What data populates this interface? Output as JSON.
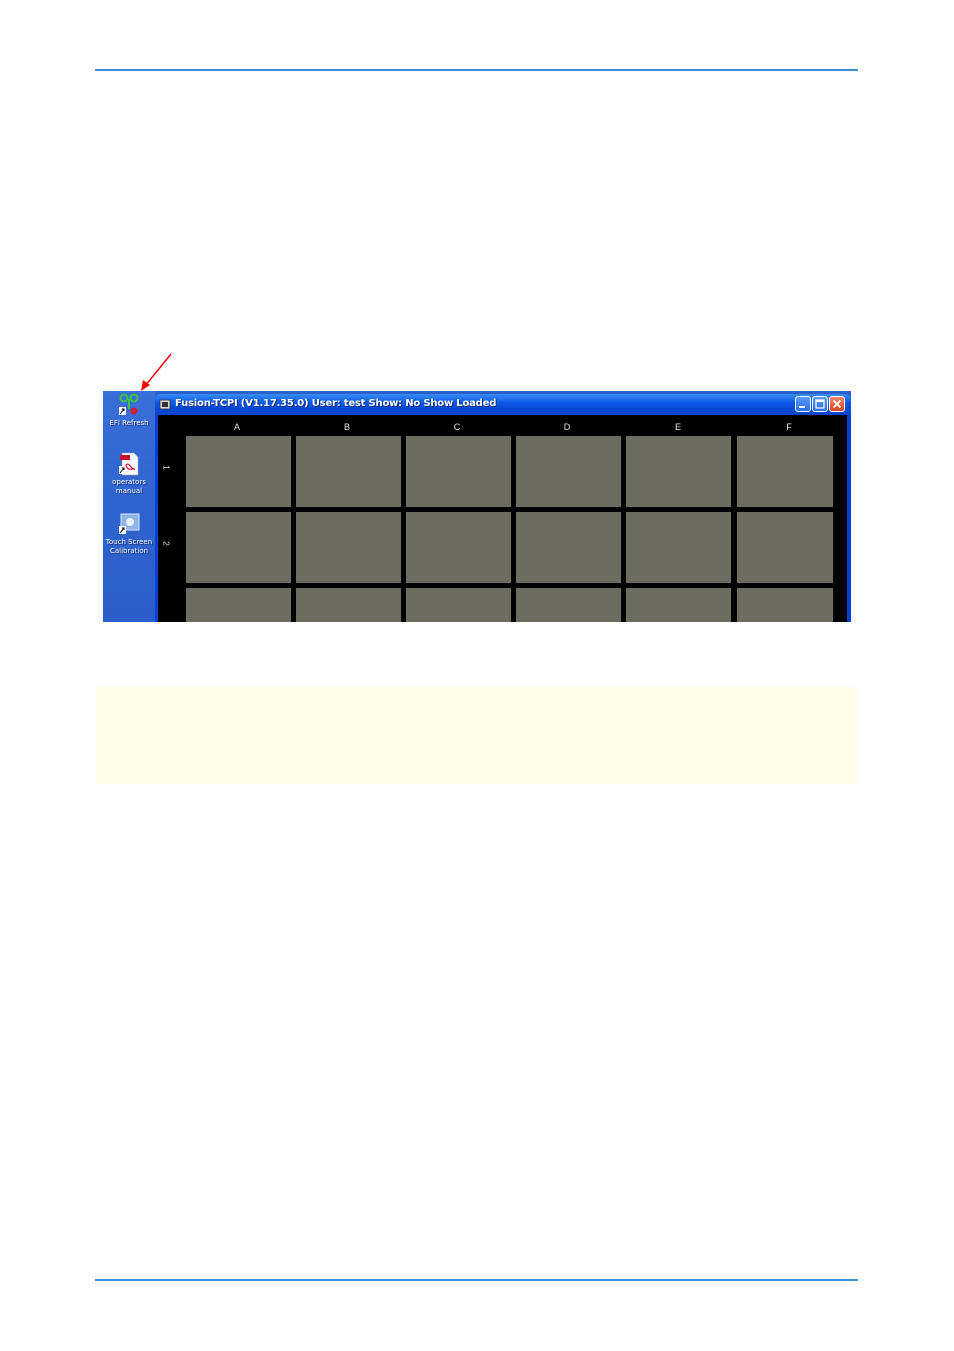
{
  "window": {
    "title": "Fusion-TCPI (V1.17.35.0)   User: test   Show: No Show Loaded"
  },
  "desktop_icons": [
    {
      "label": "EFI Refresh",
      "icon": "efi-refresh-icon"
    },
    {
      "label": "operators manual",
      "icon": "pdf-icon"
    },
    {
      "label": "Touch Screen Calibration",
      "icon": "touch-calibration-icon"
    }
  ],
  "grid": {
    "columns": [
      "A",
      "B",
      "C",
      "D",
      "E",
      "F"
    ],
    "rows": [
      "1",
      "2"
    ]
  },
  "colors": {
    "accent_rule": "#3d8fe0",
    "tile": "#6d6c60",
    "note_bg": "#fffdea",
    "arrow": "#ff0000"
  }
}
